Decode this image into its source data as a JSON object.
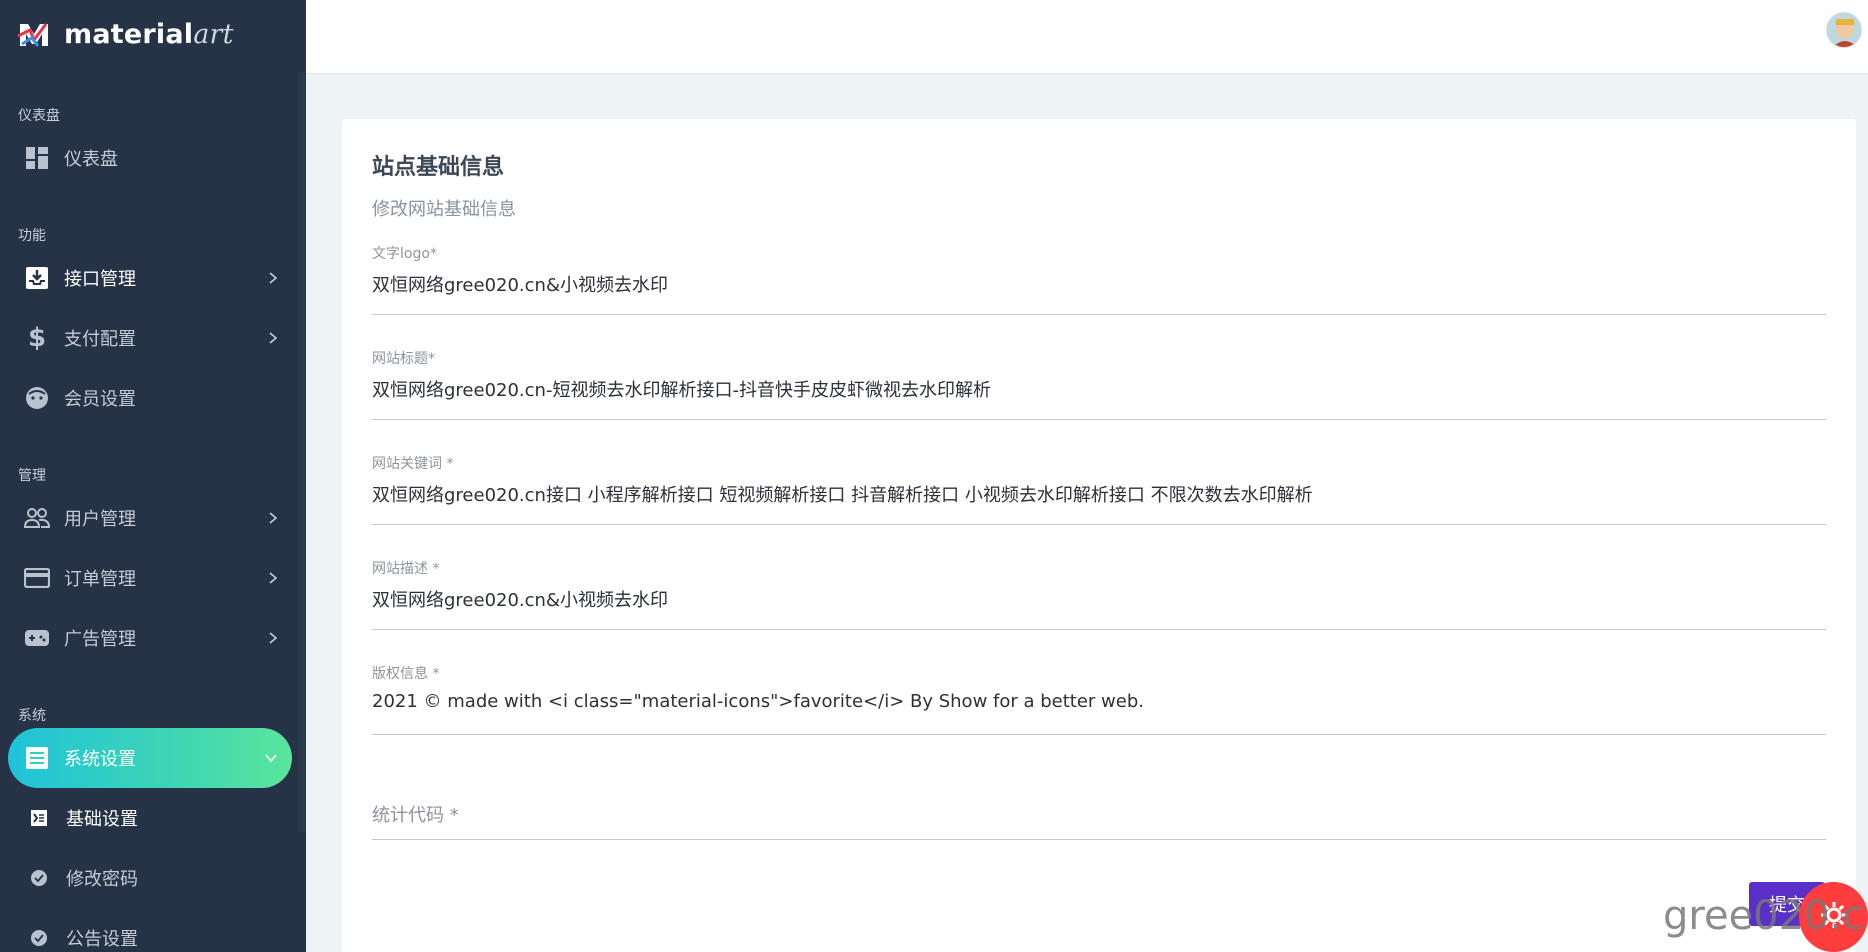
{
  "brand": {
    "name_main": "material",
    "name_accent": "art"
  },
  "sidebar": {
    "sections": [
      {
        "label": "仪表盘",
        "items": [
          {
            "label": "仪表盘",
            "icon": "dashboard-icon"
          }
        ]
      },
      {
        "label": "功能",
        "items": [
          {
            "label": "接口管理",
            "icon": "inbox-download-icon"
          },
          {
            "label": "支付配置",
            "icon": "dollar-icon"
          },
          {
            "label": "会员设置",
            "icon": "face-icon"
          }
        ]
      },
      {
        "label": "管理",
        "items": [
          {
            "label": "用户管理",
            "icon": "people-icon"
          },
          {
            "label": "订单管理",
            "icon": "card-icon"
          },
          {
            "label": "广告管理",
            "icon": "gamepad-icon"
          }
        ]
      },
      {
        "label": "系统",
        "items": [
          {
            "label": "系统设置",
            "icon": "list-icon"
          }
        ]
      }
    ],
    "sub_items": [
      {
        "label": "基础设置",
        "icon": "indent-icon"
      },
      {
        "label": "修改密码",
        "icon": "check-circle-icon"
      },
      {
        "label": "公告设置",
        "icon": "check-circle-icon"
      }
    ],
    "active_color_start": "#1fc3d9",
    "active_color_end": "#59e59b",
    "background": "#263246"
  },
  "card": {
    "title": "站点基础信息",
    "subtitle": "修改网站基础信息",
    "fields": [
      {
        "label": "文字logo*",
        "value": "双恒网络gree020.cn&小视频去水印"
      },
      {
        "label": "网站标题*",
        "value": "双恒网络gree020.cn-短视频去水印解析接口-抖音快手皮皮虾微视去水印解析"
      },
      {
        "label": "网站关键词 *",
        "value": "双恒网络gree020.cn接口 小程序解析接口 短视频解析接口 抖音解析接口 小视频去水印解析接口 不限次数去水印解析"
      },
      {
        "label": "网站描述 *",
        "value": "双恒网络gree020.cn&小视频去水印"
      },
      {
        "label": "版权信息 *",
        "value": "2021 © made with <i class=\"material-icons\">favorite</i> By Show for a better web."
      }
    ],
    "stats_field": {
      "placeholder": "统计代码 *"
    },
    "submit_label": "提交",
    "submit_color": "#5a30c8"
  },
  "watermark": "gree020.cn"
}
